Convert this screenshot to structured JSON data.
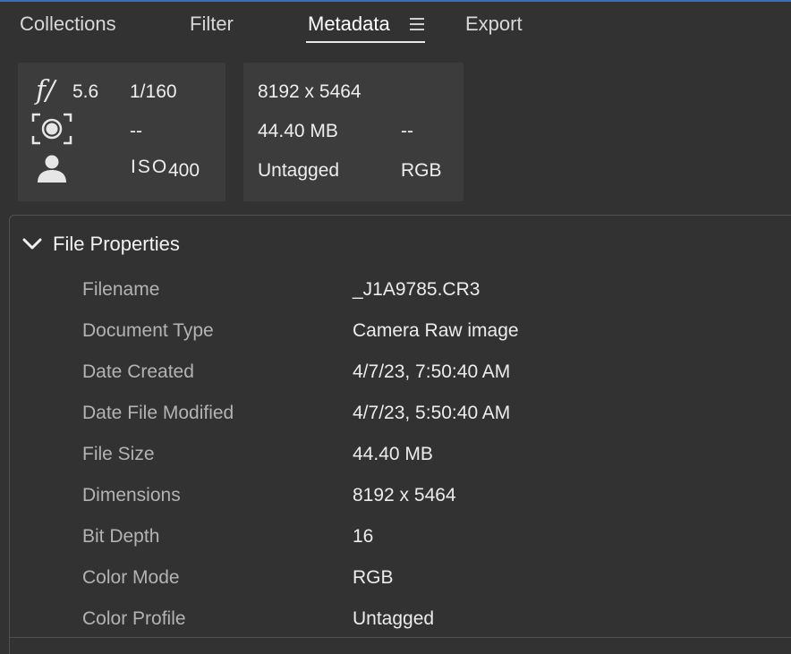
{
  "tabs": [
    {
      "label": "Collections"
    },
    {
      "label": "Filter"
    },
    {
      "label": "Metadata"
    },
    {
      "label": "Export"
    }
  ],
  "summary": {
    "fstop_symbol": "f/",
    "aperture": "5.6",
    "shutter": "1/160",
    "metering": "--",
    "iso_label": "ISO",
    "iso": "400",
    "dimensions": "8192 x 5464",
    "file_size": "44.40 MB",
    "extra": "--",
    "profile": "Untagged",
    "color_mode": "RGB"
  },
  "file_properties": {
    "title": "File Properties",
    "rows": [
      {
        "label": "Filename",
        "value": "_J1A9785.CR3"
      },
      {
        "label": "Document Type",
        "value": "Camera Raw image"
      },
      {
        "label": "Date Created",
        "value": "4/7/23, 7:50:40 AM"
      },
      {
        "label": "Date File Modified",
        "value": "4/7/23, 5:50:40 AM"
      },
      {
        "label": "File Size",
        "value": "44.40 MB"
      },
      {
        "label": "Dimensions",
        "value": "8192 x 5464"
      },
      {
        "label": "Bit Depth",
        "value": "16"
      },
      {
        "label": "Color Mode",
        "value": "RGB"
      },
      {
        "label": "Color Profile",
        "value": "Untagged"
      }
    ]
  },
  "colors": {
    "background": "#323232",
    "summary_box": "#3c3c3c",
    "accent_border": "#3d6fb6"
  }
}
